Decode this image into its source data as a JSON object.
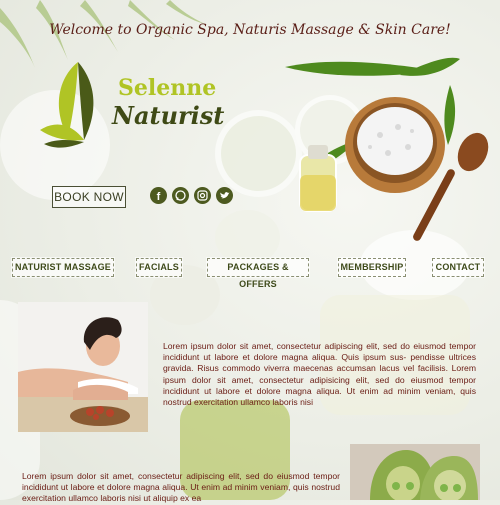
{
  "header": {
    "welcome_text": "Welcome to Organic Spa, Naturis Massage & Skin Care!"
  },
  "logo": {
    "line1": "Selenne",
    "line2": "Naturist",
    "colors": {
      "accent": "#b0c425",
      "dark": "#3f4a16"
    }
  },
  "actions": {
    "book_now_label": "BOOK NOW"
  },
  "social": [
    {
      "icon": "facebook-icon"
    },
    {
      "icon": "whatsapp-icon"
    },
    {
      "icon": "instagram-icon"
    },
    {
      "icon": "twitter-icon"
    }
  ],
  "nav": {
    "items": [
      {
        "label": "NATURIST MASSAGE"
      },
      {
        "label": "FACIALS"
      },
      {
        "label": "PACKAGES & OFFERS"
      },
      {
        "label": "MEMBERSHIP"
      },
      {
        "label": "CONTACT"
      }
    ]
  },
  "content": {
    "paragraph1": "Lorem ipsum dolor sit amet, consectetur adipiscing elit, sed do eiusmod tempor incididunt ut labore et dolore magna aliqua. Quis ipsum sus- pendisse ultrices gravida. Risus commodo viverra maecenas accumsan lacus vel facilisis. Lorem ipsum dolor sit amet, consectetur adipisicing elit, sed do eiusmod tempor incididunt ut labore et dolore magna aliqua. Ut enim ad minim veniam, quis nostrud exercitation ullamco laboris nisi",
    "paragraph2": "Lorem ipsum dolor sit amet, consectetur adipiscing elit, sed do eiusmod tempor incididunt ut labore et dolore magna aliqua. Ut enim ad minim veniam, quis nostrud exercitation ullamco laboris nisi ut aliquip ex ea"
  },
  "colors": {
    "text_brown": "#6a1c14",
    "nav_text": "#3e4a1a",
    "icon_green": "#4d5a20"
  }
}
